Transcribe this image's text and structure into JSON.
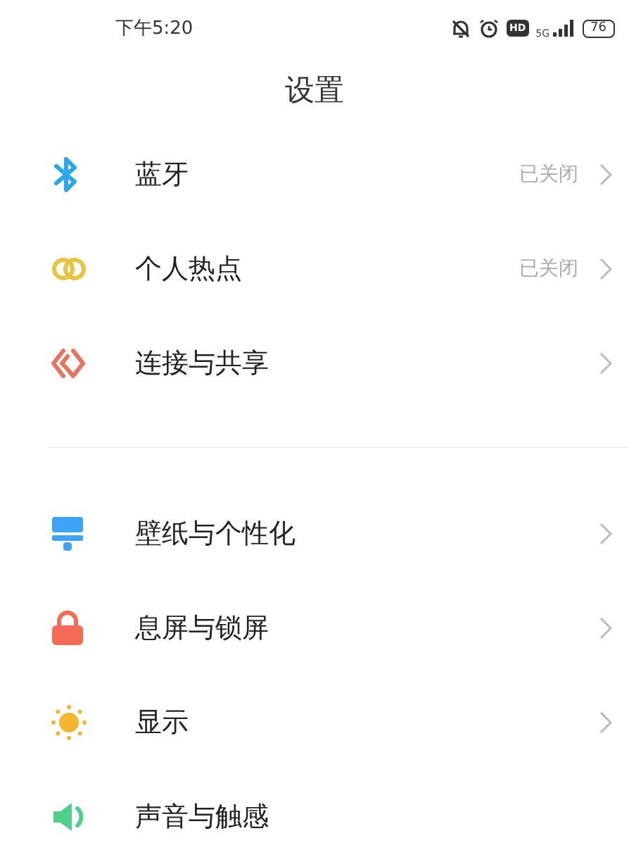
{
  "status_bar": {
    "time": "下午5:20",
    "hd": "HD",
    "network": "5G",
    "battery": "76"
  },
  "title": "设置",
  "sections": [
    {
      "items": [
        {
          "label": "蓝牙",
          "status": "已关闭",
          "chevron": true
        },
        {
          "label": "个人热点",
          "status": "已关闭",
          "chevron": true
        },
        {
          "label": "连接与共享",
          "chevron": true
        }
      ]
    },
    {
      "items": [
        {
          "label": "壁纸与个性化",
          "chevron": true
        },
        {
          "label": "息屏与锁屏",
          "chevron": true
        },
        {
          "label": "显示",
          "chevron": true
        },
        {
          "label": "声音与触感",
          "chevron": false
        }
      ]
    }
  ]
}
